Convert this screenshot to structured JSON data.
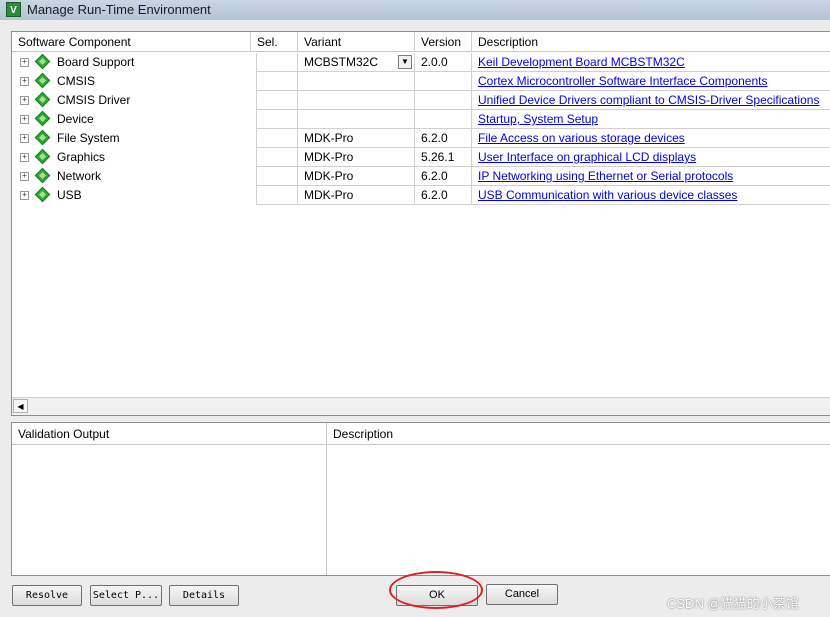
{
  "window": {
    "title": "Manage Run-Time Environment",
    "icon_text": "V"
  },
  "columns": {
    "component": "Software Component",
    "sel": "Sel.",
    "variant": "Variant",
    "version": "Version",
    "description": "Description"
  },
  "components": [
    {
      "name": "Board Support",
      "variant": "MCBSTM32C",
      "has_dropdown": true,
      "version": "2.0.0",
      "description": "Keil Development Board MCBSTM32C"
    },
    {
      "name": "CMSIS",
      "variant": "",
      "has_dropdown": false,
      "version": "",
      "description": "Cortex Microcontroller Software Interface Components"
    },
    {
      "name": "CMSIS Driver",
      "variant": "",
      "has_dropdown": false,
      "version": "",
      "description": "Unified Device Drivers compliant to CMSIS-Driver Specifications"
    },
    {
      "name": "Device",
      "variant": "",
      "has_dropdown": false,
      "version": "",
      "description": "Startup, System Setup"
    },
    {
      "name": "File System",
      "variant": "MDK-Pro",
      "has_dropdown": false,
      "version": "6.2.0",
      "description": "File Access on various storage devices"
    },
    {
      "name": "Graphics",
      "variant": "MDK-Pro",
      "has_dropdown": false,
      "version": "5.26.1",
      "description": "User Interface on graphical LCD displays"
    },
    {
      "name": "Network",
      "variant": "MDK-Pro",
      "has_dropdown": false,
      "version": "6.2.0",
      "description": "IP Networking using Ethernet or Serial protocols"
    },
    {
      "name": "USB",
      "variant": "MDK-Pro",
      "has_dropdown": false,
      "version": "6.2.0",
      "description": "USB Communication with various device classes"
    }
  ],
  "validation": {
    "output_header": "Validation Output",
    "description_header": "Description"
  },
  "buttons": {
    "resolve": "Resolve",
    "select": "Select P...",
    "details": "Details",
    "ok": "OK",
    "cancel": "Cancel"
  },
  "watermark": "CSDN @猫猫的小茶馆",
  "colors": {
    "link": "#0000ee",
    "component_icon": "#2fa833",
    "highlight_circle": "#e02020"
  }
}
